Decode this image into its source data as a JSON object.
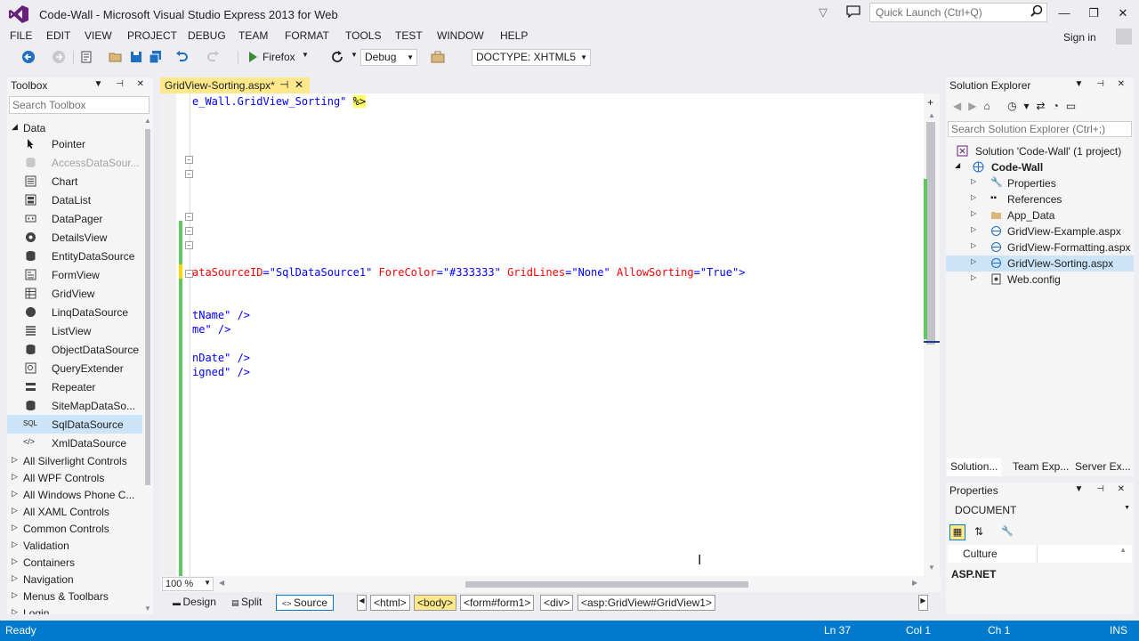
{
  "window": {
    "title": "Code-Wall - Microsoft Visual Studio Express 2013 for Web",
    "quick_launch_placeholder": "Quick Launch (Ctrl+Q)"
  },
  "menu": [
    "FILE",
    "EDIT",
    "VIEW",
    "PROJECT",
    "DEBUG",
    "TEAM",
    "FORMAT",
    "TOOLS",
    "TEST",
    "WINDOW",
    "HELP"
  ],
  "signin": "Sign in",
  "toolbar": {
    "browser": "Firefox",
    "config": "Debug",
    "doctype": "DOCTYPE: XHTML5"
  },
  "toolbox": {
    "title": "Toolbox",
    "search_placeholder": "Search Toolbox",
    "data_group": "Data",
    "items": [
      "Pointer",
      "AccessDataSour...",
      "Chart",
      "DataList",
      "DataPager",
      "DetailsView",
      "EntityDataSource",
      "FormView",
      "GridView",
      "LinqDataSource",
      "ListView",
      "ObjectDataSource",
      "QueryExtender",
      "Repeater",
      "SiteMapDataSo...",
      "SqlDataSource",
      "XmlDataSource"
    ],
    "groups": [
      "All Silverlight Controls",
      "All WPF Controls",
      "All Windows Phone C...",
      "All XAML Controls",
      "Common Controls",
      "Validation",
      "Containers",
      "Navigation",
      "Menus & Toolbars",
      "Login"
    ]
  },
  "editor": {
    "tab": "GridView-Sorting.aspx*",
    "line1_text": "e_Wall.GridView_Sorting\"",
    "line1_dir": "%>",
    "line_gv_attr1": "ataSourceID",
    "line_gv_val1": "\"SqlDataSource1\"",
    "line_gv_attr2": "ForeColor",
    "line_gv_val2": "\"#333333\"",
    "line_gv_attr3": "GridLines",
    "line_gv_val3": "\"None\"",
    "line_gv_attr4": "AllowSorting",
    "line_gv_val4": "\"True\"",
    "line_a": "tName\" />",
    "line_b": "me\" />",
    "line_c": "nDate\" />",
    "line_d": "igned\" />",
    "zoom": "100 %"
  },
  "views": [
    "Design",
    "Split",
    "Source"
  ],
  "breadcrumbs": [
    "<html>",
    "<body>",
    "<form#form1>",
    "<div>",
    "<asp:GridView#GridView1>"
  ],
  "solution_explorer": {
    "title": "Solution Explorer",
    "search_placeholder": "Search Solution Explorer (Ctrl+;)",
    "solution": "Solution 'Code-Wall' (1 project)",
    "project": "Code-Wall",
    "items": [
      "Properties",
      "References",
      "App_Data",
      "GridView-Example.aspx",
      "GridView-Formatting.aspx",
      "GridView-Sorting.aspx",
      "Web.config"
    ],
    "tabs": [
      "Solution...",
      "Team Exp...",
      "Server Ex..."
    ]
  },
  "properties": {
    "title": "Properties",
    "object": "DOCUMENT",
    "row_label": "Culture",
    "category": "ASP.NET"
  },
  "status": {
    "ready": "Ready",
    "ln": "Ln 37",
    "col": "Col 1",
    "ch": "Ch 1",
    "mode": "INS"
  },
  "colors": {
    "accent": "#007acc",
    "tab_modified": "#fde98c",
    "change_bar": "#5fc85f"
  }
}
